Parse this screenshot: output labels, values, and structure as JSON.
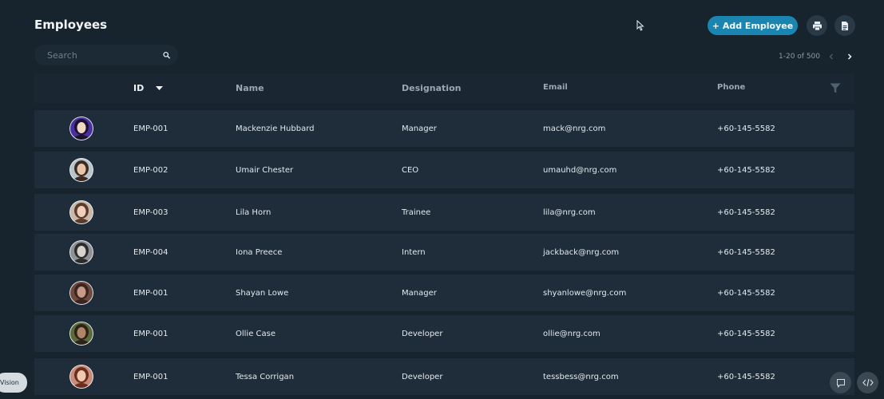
{
  "header": {
    "title": "Employees",
    "add_button_label": "+ Add Employee"
  },
  "toolbar": {
    "print_icon": "printer-icon",
    "export_icon": "document-icon"
  },
  "search": {
    "placeholder": "Search",
    "value": ""
  },
  "pagination": {
    "range_text": "1-20 of 500"
  },
  "table": {
    "columns": {
      "id": "ID",
      "name": "Name",
      "designation": "Designation",
      "email": "Email",
      "phone": "Phone"
    },
    "sort_column": "ID",
    "rows": [
      {
        "id": "EMP-001",
        "name": "Mackenzie Hubbard",
        "designation": "Manager",
        "email": "mack@nrg.com",
        "phone": "+60-145-5582"
      },
      {
        "id": "EMP-002",
        "name": "Umair Chester",
        "designation": "CEO",
        "email": "umauhd@nrg.com",
        "phone": "+60-145-5582"
      },
      {
        "id": "EMP-003",
        "name": "Lila Horn",
        "designation": "Trainee",
        "email": "lila@nrg.com",
        "phone": "+60-145-5582"
      },
      {
        "id": "EMP-004",
        "name": "Iona Preece",
        "designation": "Intern",
        "email": "jackback@nrg.com",
        "phone": "+60-145-5582"
      },
      {
        "id": "EMP-001",
        "name": "Shayan Lowe",
        "designation": "Manager",
        "email": "shyanlowe@nrg.com",
        "phone": "+60-145-5582"
      },
      {
        "id": "EMP-001",
        "name": "Ollie Case",
        "designation": "Developer",
        "email": "ollie@nrg.com",
        "phone": "+60-145-5582"
      },
      {
        "id": "EMP-001",
        "name": "Tessa Corrigan",
        "designation": "Developer",
        "email": "tessbess@nrg.com",
        "phone": "+60-145-5582"
      }
    ]
  },
  "footer": {
    "vision_label": "Vision"
  },
  "colors": {
    "background": "#17232d",
    "row": "#1e2d39",
    "accent": "#1a85b0"
  }
}
